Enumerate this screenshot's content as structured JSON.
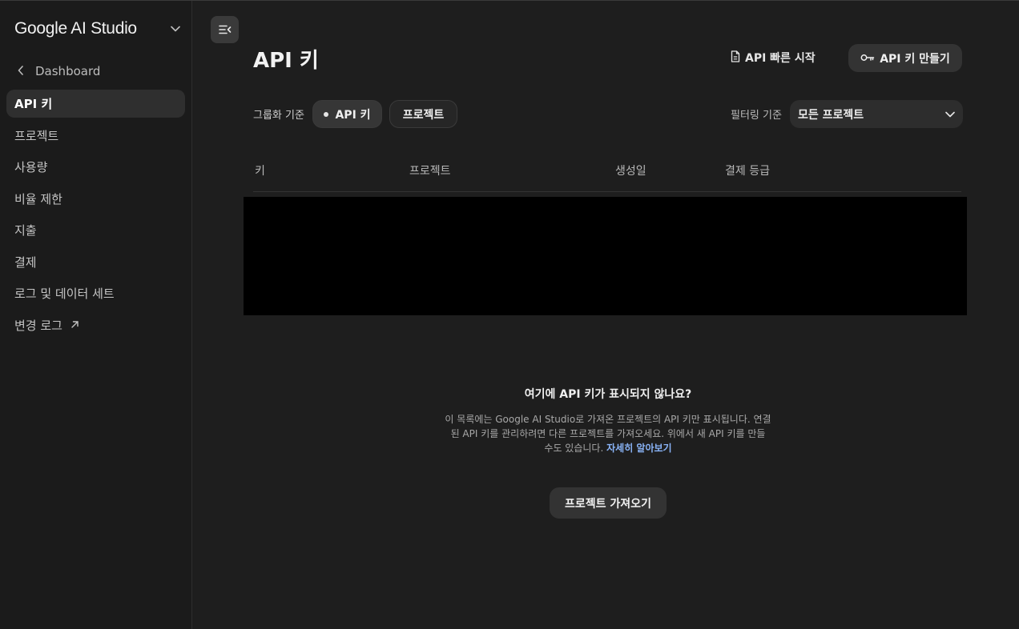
{
  "sidebar": {
    "brand": "Google AI Studio",
    "back_label": "Dashboard",
    "items": [
      {
        "label": "API 키",
        "active": true
      },
      {
        "label": "프로젝트"
      },
      {
        "label": "사용량"
      },
      {
        "label": "비율 제한"
      },
      {
        "label": "지출"
      },
      {
        "label": "결제"
      },
      {
        "label": "로그 및 데이터 세트"
      },
      {
        "label": "변경 로그",
        "external": true
      }
    ]
  },
  "header": {
    "title": "API 키",
    "quickstart_label": "API 빠른 시작",
    "create_label": "API 키 만들기"
  },
  "controls": {
    "group_label": "그룹화 기준",
    "group_options": [
      "API 키",
      "프로젝트"
    ],
    "filter_label": "필터링 기준",
    "filter_value": "모든 프로젝트"
  },
  "table": {
    "headers": [
      "키",
      "프로젝트",
      "생성일",
      "결제 등급"
    ]
  },
  "empty_state": {
    "title": "여기에 API 키가 표시되지 않나요?",
    "line1": "이 목록에는 Google AI Studio로 가져온 프로젝트의 API 키만 표시됩니다. 연결",
    "line2": "된 API 키를 관리하려면 다른 프로젝트를 가져오세요. 위에서 새 API 키를 만들",
    "line3": "수도 있습니다.",
    "link": "자세히 알아보기",
    "button": "프로젝트 가져오기"
  },
  "colors": {
    "background": "#1e1e1e",
    "sidebar": "#1b1b1b",
    "active_item": "#2f2f2f",
    "button": "#333333",
    "link": "#8ab4f8"
  }
}
